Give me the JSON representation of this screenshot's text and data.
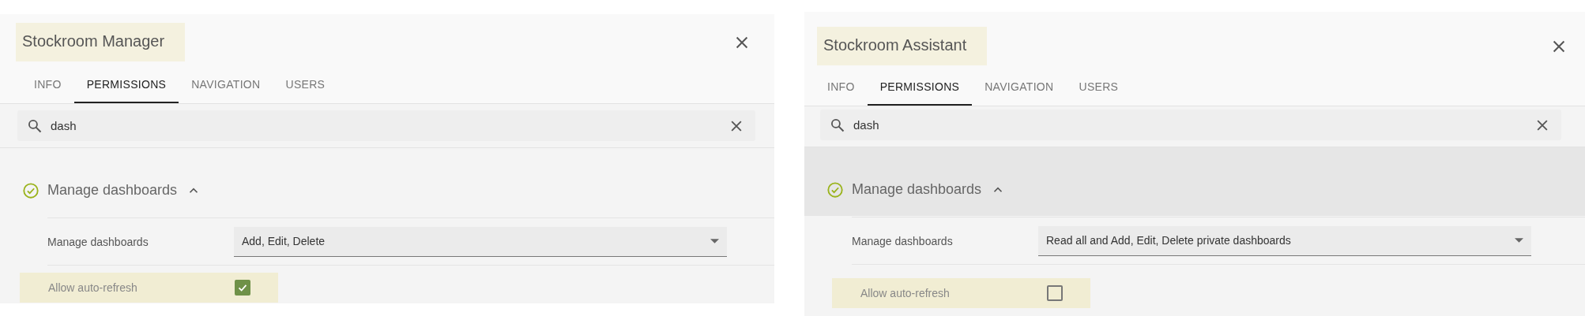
{
  "panels": [
    {
      "title": {
        "text": "Stockroom Manager",
        "highlighted": true
      },
      "tabs": [
        {
          "label": "INFO",
          "selected": false
        },
        {
          "label": "PERMISSIONS",
          "selected": true
        },
        {
          "label": "NAVIGATION",
          "selected": false
        },
        {
          "label": "USERS",
          "selected": false
        }
      ],
      "search": {
        "value": "dash"
      },
      "section": {
        "title": "Manage dashboards",
        "expanded": true,
        "hovered": false,
        "rows": [
          {
            "kind": "select",
            "label": "Manage dashboards",
            "value": "Add, Edit, Delete"
          },
          {
            "kind": "checkbox",
            "label": "Allow auto-refresh",
            "checked": true,
            "highlighted": true
          }
        ]
      }
    },
    {
      "title": {
        "text": "Stockroom Assistant",
        "highlighted": true
      },
      "tabs": [
        {
          "label": "INFO",
          "selected": false
        },
        {
          "label": "PERMISSIONS",
          "selected": true
        },
        {
          "label": "NAVIGATION",
          "selected": false
        },
        {
          "label": "USERS",
          "selected": false
        }
      ],
      "search": {
        "value": "dash"
      },
      "section": {
        "title": "Manage dashboards",
        "expanded": true,
        "hovered": true,
        "rows": [
          {
            "kind": "select",
            "label": "Manage dashboards",
            "value": "Read all and Add, Edit, Delete private dashboards"
          },
          {
            "kind": "checkbox",
            "label": "Allow auto-refresh",
            "checked": false,
            "highlighted": true
          }
        ]
      }
    }
  ]
}
